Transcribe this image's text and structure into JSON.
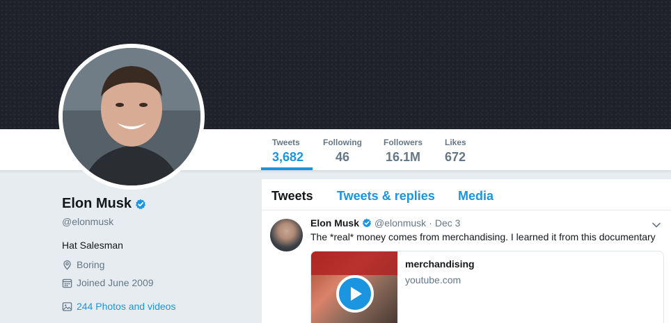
{
  "profile": {
    "display_name": "Elon Musk",
    "handle": "@elonmusk",
    "bio": "Hat Salesman",
    "location": "Boring",
    "joined": "Joined June 2009",
    "photos_link": "244 Photos and videos"
  },
  "stats": [
    {
      "label": "Tweets",
      "value": "3,682"
    },
    {
      "label": "Following",
      "value": "46"
    },
    {
      "label": "Followers",
      "value": "16.1M"
    },
    {
      "label": "Likes",
      "value": "672"
    }
  ],
  "tabs": [
    {
      "label": "Tweets"
    },
    {
      "label": "Tweets & replies"
    },
    {
      "label": "Media"
    }
  ],
  "tweet": {
    "name": "Elon Musk",
    "handle": "@elonmusk",
    "separator": "·",
    "date": "Dec 3",
    "text": "The *real* money comes from merchandising. I learned it from this documentary",
    "card_title": "merchandising",
    "card_domain": "youtube.com"
  },
  "colors": {
    "accent": "#1b95e0",
    "header_bg": "#20222b",
    "page_bg": "#e6ecf0",
    "muted_text": "#657786"
  },
  "icons": [
    "verified-badge-icon",
    "location-pin-icon",
    "calendar-icon",
    "photo-icon",
    "chevron-down-icon",
    "play-icon"
  ]
}
